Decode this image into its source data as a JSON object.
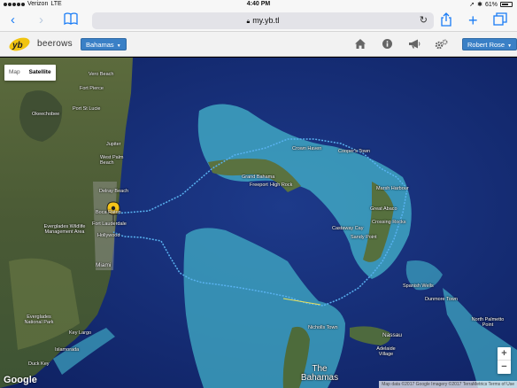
{
  "status_bar": {
    "carrier": "Verizon",
    "network": "LTE",
    "time": "4:40 PM",
    "battery": "61%"
  },
  "browser": {
    "url": "my.yb.tl",
    "icons": {
      "back": "chevron-left-icon",
      "forward": "chevron-right-icon",
      "bookmarks": "book-icon",
      "reload": "reload-icon",
      "share": "share-icon",
      "new_tab": "plus-icon",
      "tabs": "tabs-icon"
    }
  },
  "site_header": {
    "site_name": "beerows",
    "region_dropdown": "Bahamas",
    "user_dropdown": "Robert Rose",
    "icons": [
      "home-icon",
      "info-icon",
      "megaphone-icon",
      "settings-icon"
    ]
  },
  "map": {
    "map_type_options": [
      "Map",
      "Satellite"
    ],
    "selected_map_type": "Satellite",
    "labels": {
      "vero_beach": "Vero Beach",
      "fort_pierce": "Fort Pierce",
      "port_st_lucie": "Port St Lucie",
      "okeechobee": "Okeechobee",
      "jupiter": "Jupiter",
      "west_palm_beach": "West Palm Beach",
      "delray_beach": "Delray Beach",
      "boca_raton": "Boca Raton",
      "fort_lauderdale": "Fort Lauderdale",
      "hollywood": "Hollywood",
      "everglades_wildlife": "Everglades Wildlife Management Area",
      "miami": "Miami",
      "everglades_np": "Everglades National Park",
      "key_largo": "Key Largo",
      "islamorada": "Islamorada",
      "duck_key": "Duck Key",
      "grand_bahama": "Grand Bahama",
      "freeport": "Freeport",
      "high_rock": "High Rock",
      "crown_haven": "Crown Haven",
      "cooper_town": "Cooper's Town",
      "marsh_harbour": "Marsh Harbour",
      "great_abaco": "Great Abaco",
      "crossing_rocks": "Crossing Rocks",
      "castaway_cay": "Castaway Cay",
      "sandy_point": "Sandy Point",
      "spanish_wells": "Spanish Wells",
      "dunmore_town": "Dunmore Town",
      "north_palmetto_point": "North Palmetto Point",
      "nicholls_town": "Nicholls Town",
      "nassau": "Nassau",
      "adelaide_village": "Adelaide Village",
      "the_bahamas": "The Bahamas"
    },
    "marker_icon": "location-pin-icon",
    "zoom_in": "+",
    "zoom_out": "−",
    "google_logo": "Google",
    "attribution": "Map data ©2017 Google Imagery ©2017 TerraMetrics  Terms of Use",
    "colors": {
      "ocean_deep": "#142a6e",
      "shallows": "#3fa6c2",
      "track": "#59b2f0",
      "track_leg": "#e8e05a",
      "marker": "#f5c518"
    }
  }
}
